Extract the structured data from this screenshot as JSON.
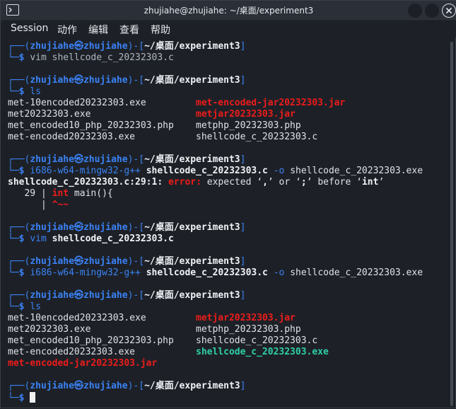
{
  "window": {
    "title": "zhujiahe@zhujiahe: ~/桌面/experiment3"
  },
  "menu": [
    "Session",
    "动作",
    "编辑",
    "查看",
    "帮助"
  ],
  "prompt": {
    "user": "zhujiahe",
    "host": "zhujiahe",
    "path": "~/桌面/experiment3",
    "symbol": "$"
  },
  "commands": {
    "c1": "vim shellcode_c_20232303.c",
    "c2": "ls",
    "c3_a": "i686-w64-mingw32-g++",
    "c3_b": "shellcode_c_20232303.c",
    "c3_c": "-o",
    "c3_d": "shellcode_c_20232303.exe",
    "c4_a": "vim",
    "c4_b": "shellcode_c_20232303.c",
    "c5_a": "i686-w64-mingw32-g++",
    "c5_b": "shellcode_c_20232303.c",
    "c5_c": "-o",
    "c5_d": "shellcode_c_20232303.exe",
    "c6": "ls"
  },
  "ls1": [
    [
      "met-10encoded20232303.exe",
      "met-encoded-jar20232303.jar"
    ],
    [
      "met20232303.exe",
      "metjar20232303.jar"
    ],
    [
      "met_encoded10_php_20232303.php",
      "metphp_20232303.php"
    ],
    [
      "met-encoded20232303.exe",
      "shellcode_c_20232303.c"
    ]
  ],
  "error": {
    "file": "shellcode_c_20232303.c:29:1:",
    "label": "error:",
    "msg1": "expected ‘",
    "c1": ",",
    "msg2": "’ or ‘",
    "c2": ";",
    "msg3": "’ before ‘",
    "kw": "int",
    "msg4": "’",
    "lineno": "   29 | ",
    "code_kw": "int",
    "code_rest": " main(){",
    "pipe": "      | ",
    "caret": "^~~"
  },
  "ls2": [
    [
      "met-10encoded20232303.exe",
      "metjar20232303.jar"
    ],
    [
      "met20232303.exe",
      "metphp_20232303.php"
    ],
    [
      "met_encoded10_php_20232303.php",
      "shellcode_c_20232303.c"
    ],
    [
      "met-encoded20232303.exe",
      "shellcode_c_20232303.exe"
    ],
    [
      "met-encoded-jar20232303.jar",
      ""
    ]
  ],
  "colors": {
    "prompt": "#3b82f6",
    "error": "#ef1b1b",
    "exec": "#2fd0a8"
  }
}
